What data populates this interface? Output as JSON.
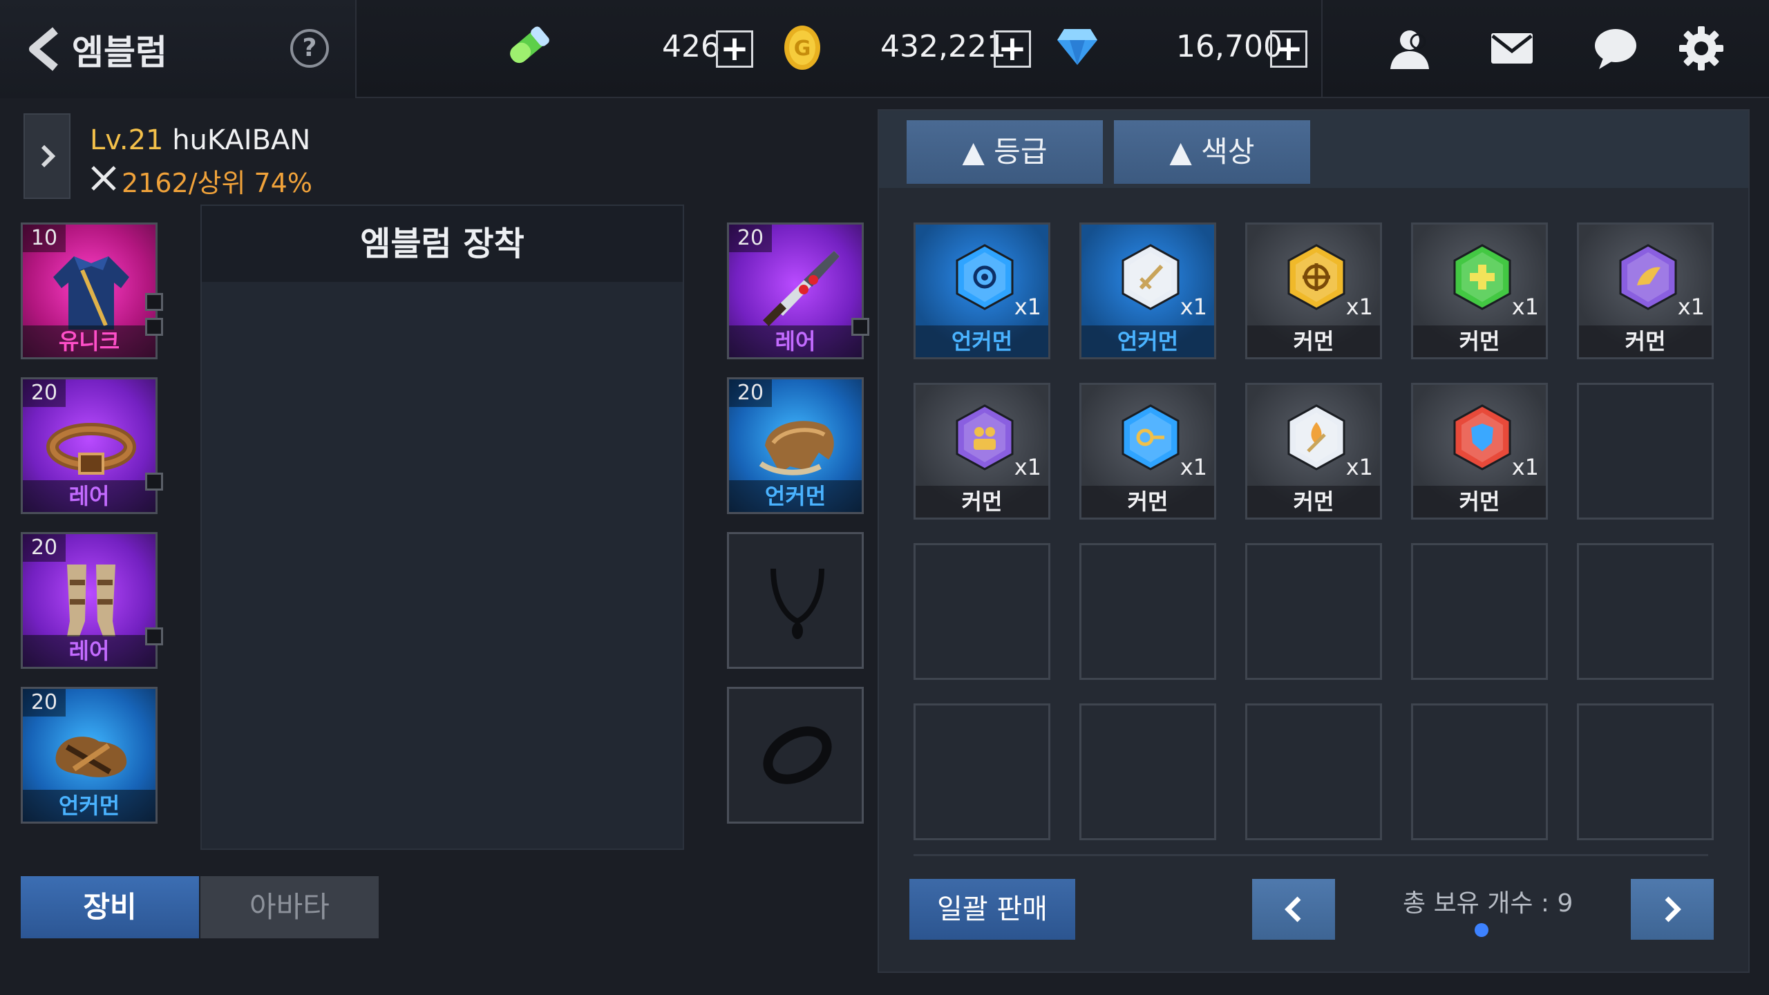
{
  "header": {
    "title": "엠블럼",
    "help_symbol": "?",
    "currencies": [
      {
        "icon": "energy-vial-icon",
        "value": "426"
      },
      {
        "icon": "gold-coin-icon",
        "value": "432,221"
      },
      {
        "icon": "diamond-gem-icon",
        "value": "16,700"
      }
    ],
    "plus_symbol": "+",
    "right_icons": [
      "friends-icon",
      "mail-icon",
      "chat-icon",
      "settings-gear-icon"
    ]
  },
  "character": {
    "level": "Lv.21",
    "name": "huKAIBAN",
    "power": "2162/상위 74%"
  },
  "equipment_left": [
    {
      "level": "10",
      "grade": "유니크",
      "grade_key": "unique",
      "item": "jacket-icon"
    },
    {
      "level": "20",
      "grade": "레어",
      "grade_key": "rare",
      "item": "belt-icon"
    },
    {
      "level": "20",
      "grade": "레어",
      "grade_key": "rare",
      "item": "boots-icon"
    },
    {
      "level": "20",
      "grade": "언커먼",
      "grade_key": "uncommon",
      "item": "gloves-icon"
    }
  ],
  "equipment_right": [
    {
      "level": "20",
      "grade": "레어",
      "grade_key": "rare",
      "item": "sword-icon"
    },
    {
      "level": "20",
      "grade": "언커먼",
      "grade_key": "uncommon",
      "item": "shoulder-armor-icon"
    },
    {
      "level": "",
      "grade": "",
      "grade_key": "empty",
      "item": "necklace-icon"
    },
    {
      "level": "",
      "grade": "",
      "grade_key": "empty",
      "item": "ring-icon"
    }
  ],
  "emblem_panel": {
    "title": "엠블럼 장착"
  },
  "tabs": {
    "equip": "장비",
    "avatar": "아바타"
  },
  "sort": {
    "grade": "▲ 등급",
    "color": "▲ 색상"
  },
  "inventory": {
    "items": [
      {
        "grade": "언커먼",
        "qty": "x1",
        "icon": "eye-emblem-icon",
        "color": "#2fa4ff"
      },
      {
        "grade": "언커먼",
        "qty": "x1",
        "icon": "sword-emblem-icon",
        "color": "#e9eef5"
      },
      {
        "grade": "커먼",
        "qty": "x1",
        "icon": "target-emblem-icon",
        "color": "#f0b92a"
      },
      {
        "grade": "커먼",
        "qty": "x1",
        "icon": "plus-emblem-icon",
        "color": "#43c843"
      },
      {
        "grade": "커먼",
        "qty": "x1",
        "icon": "wing-emblem-icon",
        "color": "#8a5fe0"
      },
      {
        "grade": "커먼",
        "qty": "x1",
        "icon": "people-emblem-icon",
        "color": "#8a5fe0"
      },
      {
        "grade": "커먼",
        "qty": "x1",
        "icon": "key-emblem-icon",
        "color": "#2fa4ff"
      },
      {
        "grade": "커먼",
        "qty": "x1",
        "icon": "fire-sword-emblem-icon",
        "color": "#e9eef5"
      },
      {
        "grade": "커먼",
        "qty": "x1",
        "icon": "shield-emblem-icon",
        "color": "#e84a3a"
      }
    ],
    "capacity": 20,
    "sell_all": "일괄 판매",
    "total": "총 보유 개수 : 9"
  },
  "colors": {
    "accent_blue": "#3c6eb3",
    "unique": "#ff4fc8",
    "rare": "#c36bff",
    "uncommon": "#4ab3ff",
    "level_gold": "#f3c04a",
    "power_orange": "#f0a23a"
  }
}
